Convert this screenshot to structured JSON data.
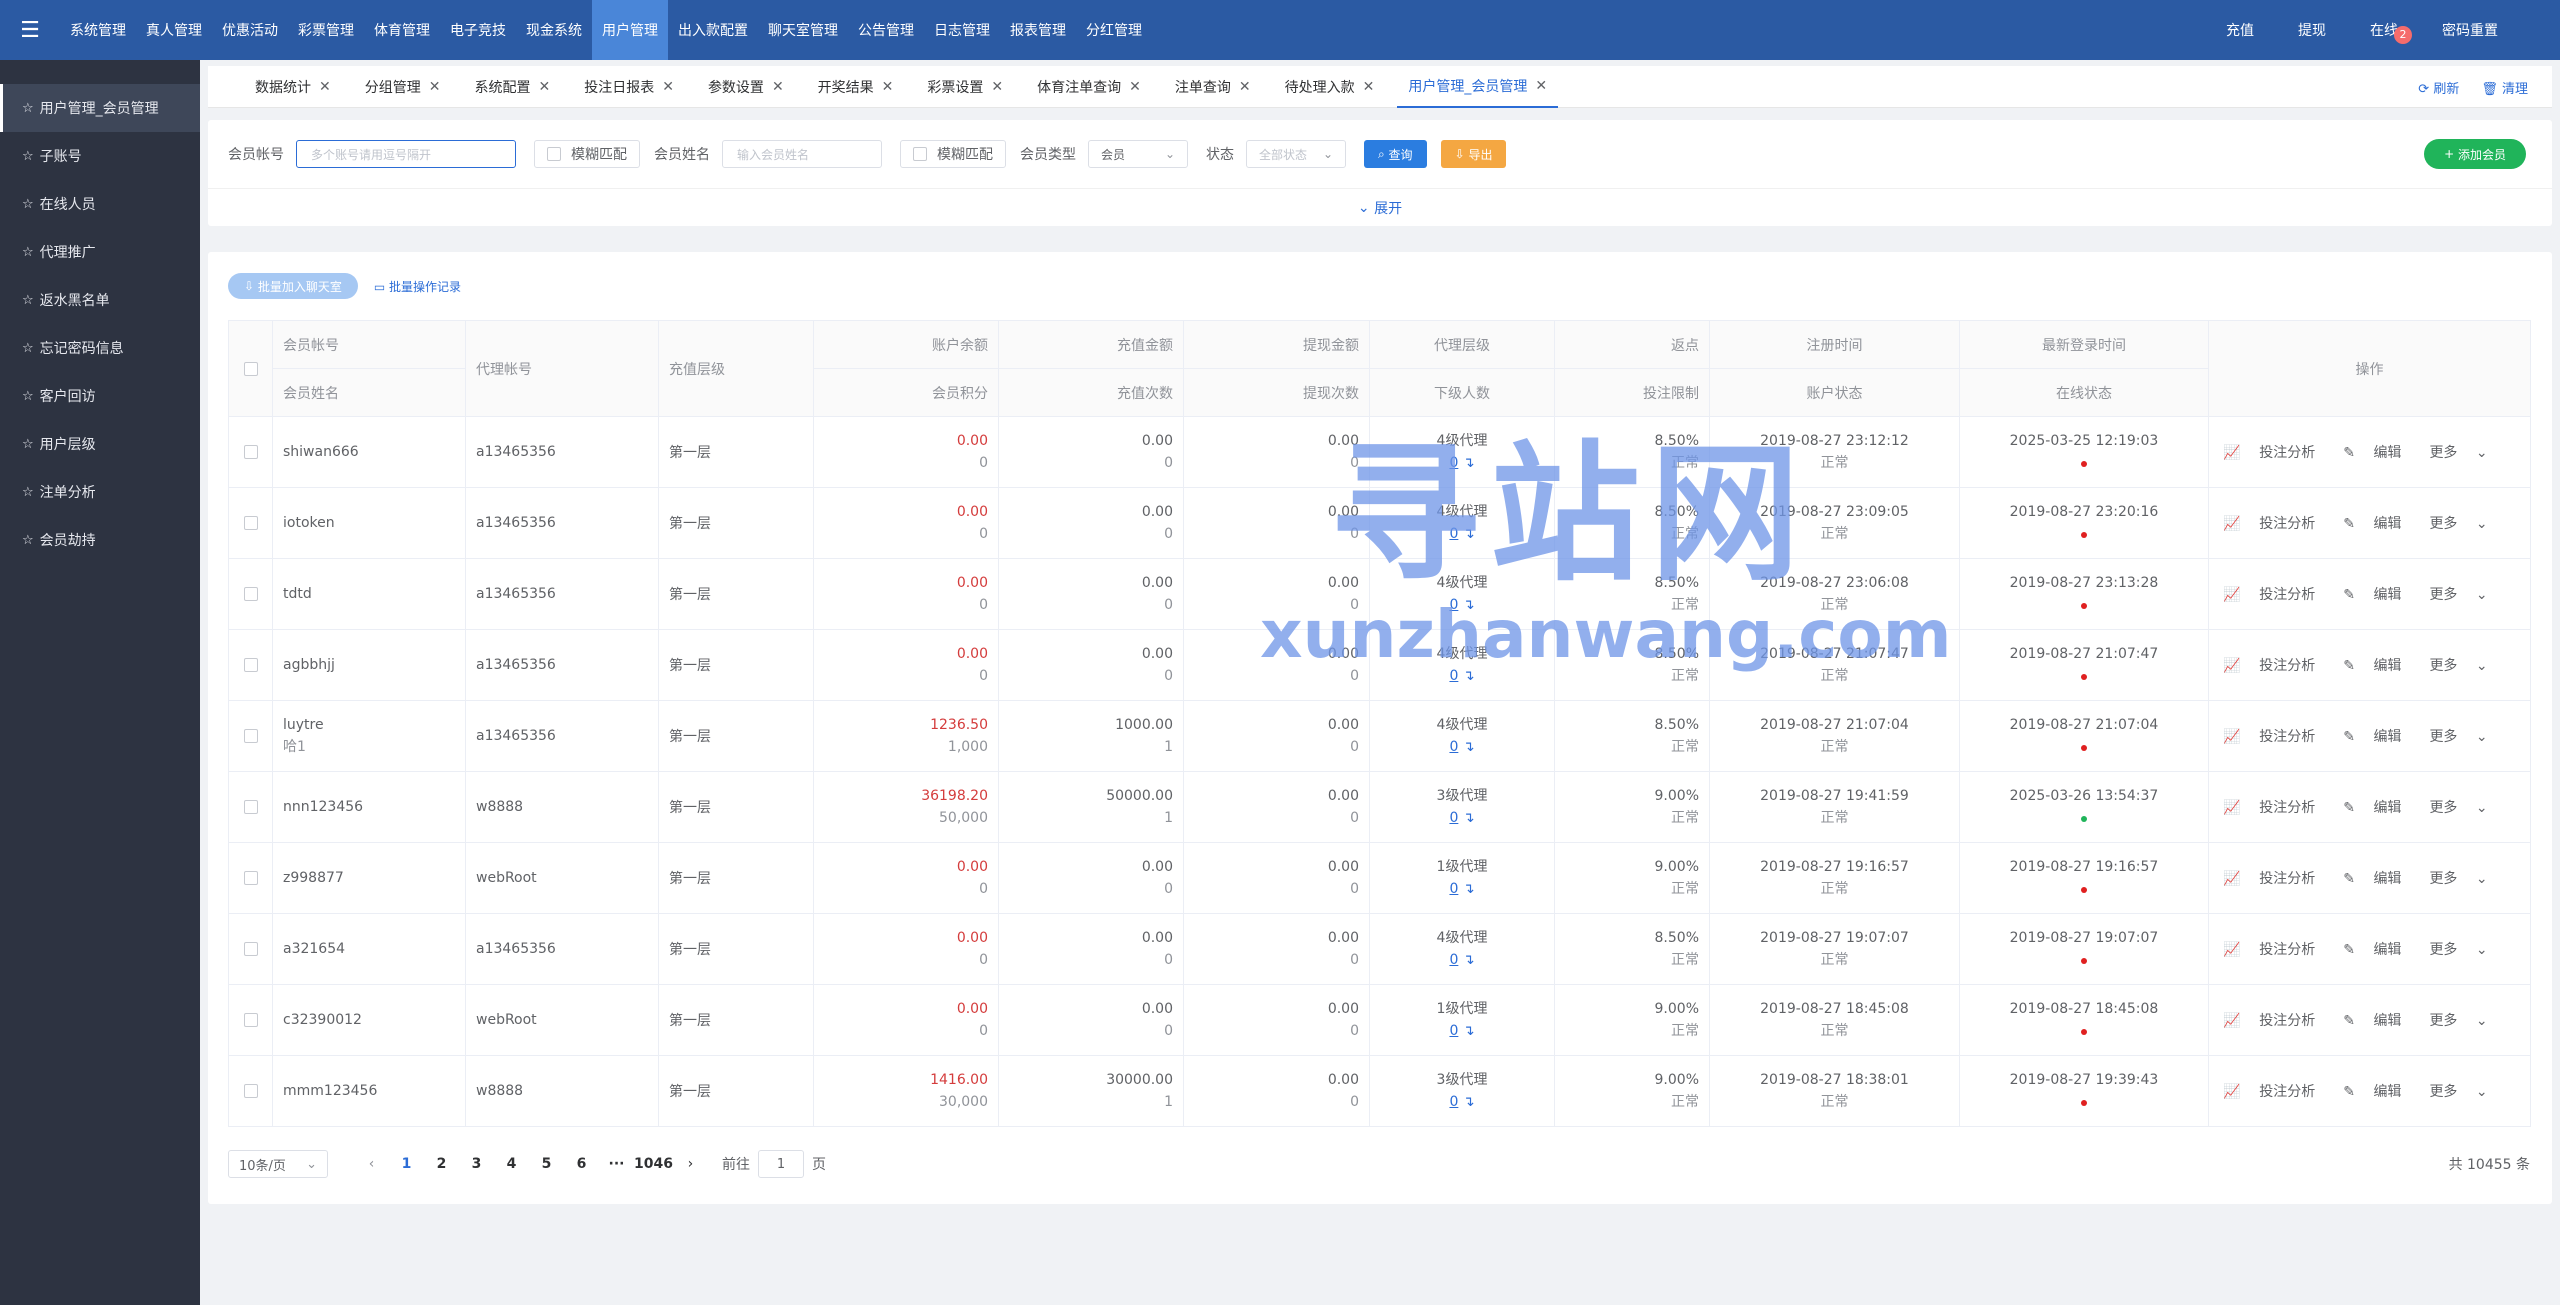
{
  "topbar": {
    "menu_icon": "menu-icon",
    "nav": [
      "系统管理",
      "真人管理",
      "优惠活动",
      "彩票管理",
      "体育管理",
      "电子竞技",
      "现金系统",
      "用户管理",
      "出入款配置",
      "聊天室管理",
      "公告管理",
      "日志管理",
      "报表管理",
      "分红管理"
    ],
    "active_nav": "用户管理",
    "right": {
      "recharge": "充值",
      "withdraw": "提现",
      "online": "在线",
      "online_badge": "2",
      "reset_pwd": "密码重置"
    }
  },
  "sidebar": {
    "items": [
      "用户管理_会员管理",
      "子账号",
      "在线人员",
      "代理推广",
      "返水黑名单",
      "忘记密码信息",
      "客户回访",
      "用户层级",
      "注单分析",
      "会员劫持"
    ]
  },
  "tabs": {
    "items": [
      "数据统计",
      "分组管理",
      "系统配置",
      "投注日报表",
      "参数设置",
      "开奖结果",
      "彩票设置",
      "体育注单查询",
      "注单查询",
      "待处理入款",
      "用户管理_会员管理"
    ],
    "refresh": "刷新",
    "clear": "清理"
  },
  "filter": {
    "account_label": "会员帐号",
    "account_placeholder": "多个账号请用逗号隔开",
    "fuzzy1": "模糊匹配",
    "name_label": "会员姓名",
    "name_placeholder": "输入会员姓名",
    "fuzzy2": "模糊匹配",
    "type_label": "会员类型",
    "type_value": "会员",
    "status_label": "状态",
    "status_value": "全部状态",
    "search_btn": "查询",
    "export_btn": "导出",
    "add_btn": "添加会员",
    "expand": "展开"
  },
  "batch": {
    "add_chat": "批量加入聊天室",
    "records": "批量操作记录"
  },
  "table": {
    "headers": {
      "account": "会员帐号",
      "name": "会员姓名",
      "agent": "代理帐号",
      "level": "充值层级",
      "balance": "账户余额",
      "points": "会员积分",
      "deposit": "充值金额",
      "deposit_count": "充值次数",
      "withdraw": "提现金额",
      "withdraw_count": "提现次数",
      "agent_level": "代理层级",
      "sub_count": "下级人数",
      "rebate": "返点",
      "bet_limit": "投注限制",
      "reg_time": "注册时间",
      "acc_status": "账户状态",
      "last_login": "最新登录时间",
      "online_status": "在线状态",
      "ops": "操作"
    },
    "ops_labels": {
      "analysis": "投注分析",
      "edit": "编辑",
      "more": "更多"
    },
    "rows": [
      {
        "account": "shiwan666",
        "name": "",
        "agent": "a13465356",
        "level": "第一层",
        "balance": "0.00",
        "points": "0",
        "deposit": "0.00",
        "deposit_count": "0",
        "withdraw": "0.00",
        "withdraw_count": "0",
        "agent_level": "4级代理",
        "sub": "0",
        "rebate": "8.50%",
        "limit": "正常",
        "reg": "2019-08-27 23:12:12",
        "status": "正常",
        "login": "2025-03-25 12:19:03",
        "online": "red"
      },
      {
        "account": "iotoken",
        "name": "",
        "agent": "a13465356",
        "level": "第一层",
        "balance": "0.00",
        "points": "0",
        "deposit": "0.00",
        "deposit_count": "0",
        "withdraw": "0.00",
        "withdraw_count": "0",
        "agent_level": "4级代理",
        "sub": "0",
        "rebate": "8.50%",
        "limit": "正常",
        "reg": "2019-08-27 23:09:05",
        "status": "正常",
        "login": "2019-08-27 23:20:16",
        "online": "red"
      },
      {
        "account": "tdtd",
        "name": "",
        "agent": "a13465356",
        "level": "第一层",
        "balance": "0.00",
        "points": "0",
        "deposit": "0.00",
        "deposit_count": "0",
        "withdraw": "0.00",
        "withdraw_count": "0",
        "agent_level": "4级代理",
        "sub": "0",
        "rebate": "8.50%",
        "limit": "正常",
        "reg": "2019-08-27 23:06:08",
        "status": "正常",
        "login": "2019-08-27 23:13:28",
        "online": "red"
      },
      {
        "account": "agbbhjj",
        "name": "",
        "agent": "a13465356",
        "level": "第一层",
        "balance": "0.00",
        "points": "0",
        "deposit": "0.00",
        "deposit_count": "0",
        "withdraw": "0.00",
        "withdraw_count": "0",
        "agent_level": "4级代理",
        "sub": "0",
        "rebate": "8.50%",
        "limit": "正常",
        "reg": "2019-08-27 21:07:47",
        "status": "正常",
        "login": "2019-08-27 21:07:47",
        "online": "red"
      },
      {
        "account": "luytre",
        "name": "哈1",
        "agent": "a13465356",
        "level": "第一层",
        "balance": "1236.50",
        "points": "1,000",
        "deposit": "1000.00",
        "deposit_count": "1",
        "withdraw": "0.00",
        "withdraw_count": "0",
        "agent_level": "4级代理",
        "sub": "0",
        "rebate": "8.50%",
        "limit": "正常",
        "reg": "2019-08-27 21:07:04",
        "status": "正常",
        "login": "2019-08-27 21:07:04",
        "online": "red"
      },
      {
        "account": "nnn123456",
        "name": "",
        "agent": "w8888",
        "level": "第一层",
        "balance": "36198.20",
        "points": "50,000",
        "deposit": "50000.00",
        "deposit_count": "1",
        "withdraw": "0.00",
        "withdraw_count": "0",
        "agent_level": "3级代理",
        "sub": "0",
        "rebate": "9.00%",
        "limit": "正常",
        "reg": "2019-08-27 19:41:59",
        "status": "正常",
        "login": "2025-03-26 13:54:37",
        "online": "green"
      },
      {
        "account": "z998877",
        "name": "",
        "agent": "webRoot",
        "level": "第一层",
        "balance": "0.00",
        "points": "0",
        "deposit": "0.00",
        "deposit_count": "0",
        "withdraw": "0.00",
        "withdraw_count": "0",
        "agent_level": "1级代理",
        "sub": "0",
        "rebate": "9.00%",
        "limit": "正常",
        "reg": "2019-08-27 19:16:57",
        "status": "正常",
        "login": "2019-08-27 19:16:57",
        "online": "red"
      },
      {
        "account": "a321654",
        "name": "",
        "agent": "a13465356",
        "level": "第一层",
        "balance": "0.00",
        "points": "0",
        "deposit": "0.00",
        "deposit_count": "0",
        "withdraw": "0.00",
        "withdraw_count": "0",
        "agent_level": "4级代理",
        "sub": "0",
        "rebate": "8.50%",
        "limit": "正常",
        "reg": "2019-08-27 19:07:07",
        "status": "正常",
        "login": "2019-08-27 19:07:07",
        "online": "red"
      },
      {
        "account": "c32390012",
        "name": "",
        "agent": "webRoot",
        "level": "第一层",
        "balance": "0.00",
        "points": "0",
        "deposit": "0.00",
        "deposit_count": "0",
        "withdraw": "0.00",
        "withdraw_count": "0",
        "agent_level": "1级代理",
        "sub": "0",
        "rebate": "9.00%",
        "limit": "正常",
        "reg": "2019-08-27 18:45:08",
        "status": "正常",
        "login": "2019-08-27 18:45:08",
        "online": "red"
      },
      {
        "account": "mmm123456",
        "name": "",
        "agent": "w8888",
        "level": "第一层",
        "balance": "1416.00",
        "points": "30,000",
        "deposit": "30000.00",
        "deposit_count": "1",
        "withdraw": "0.00",
        "withdraw_count": "0",
        "agent_level": "3级代理",
        "sub": "0",
        "rebate": "9.00%",
        "limit": "正常",
        "reg": "2019-08-27 18:38:01",
        "status": "正常",
        "login": "2019-08-27 19:39:43",
        "online": "red"
      }
    ]
  },
  "pager": {
    "page_size": "10条/页",
    "pages": [
      "1",
      "2",
      "3",
      "4",
      "5",
      "6",
      "···",
      "1046"
    ],
    "current": "1",
    "goto_label": "前往",
    "goto_value": "1",
    "goto_suffix": "页",
    "total": "共 10455 条"
  },
  "watermark": {
    "cn": "寻站网",
    "en": "xunzhanwang.com"
  },
  "colors": {
    "topbar": "#2b5aa3",
    "sidebar": "#2d3341",
    "accent": "#2b6cd6",
    "negative": "#d43c3c",
    "online": "#20b45a"
  }
}
